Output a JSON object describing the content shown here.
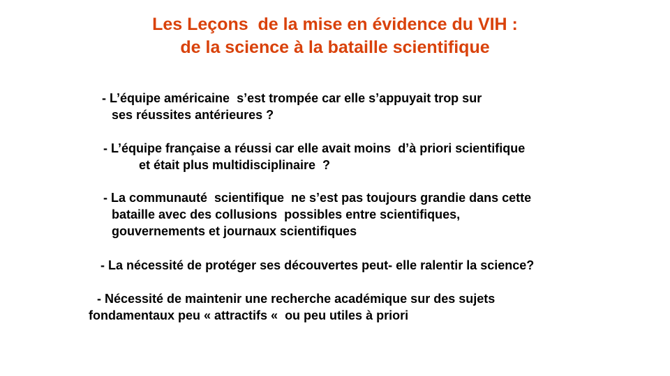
{
  "title": {
    "line1": "Les Leçons  de la mise en évidence du VIH :",
    "line2": "de la science à la bataille scientifique"
  },
  "bullets": [
    {
      "line1": "- L’équipe américaine  s’est trompée car elle s’appuyait trop sur",
      "line2": "ses réussites antérieures ?"
    },
    {
      "line1": "- L’équipe française a réussi car elle avait moins  d’à priori scientifique",
      "line2": "et était plus multidisciplinaire  ?"
    },
    {
      "line1": "- La communauté  scientifique  ne s’est pas toujours grandie dans cette",
      "line2": "bataille avec des collusions  possibles entre scientifiques,",
      "line3": "gouvernements et journaux scientifiques"
    },
    {
      "line1": "- La nécessité de protéger ses découvertes peut- elle ralentir la science?"
    },
    {
      "line1": "- Nécessité de maintenir une recherche académique sur des sujets",
      "line2": "fondamentaux peu « attractifs «  ou peu utiles à priori"
    }
  ]
}
